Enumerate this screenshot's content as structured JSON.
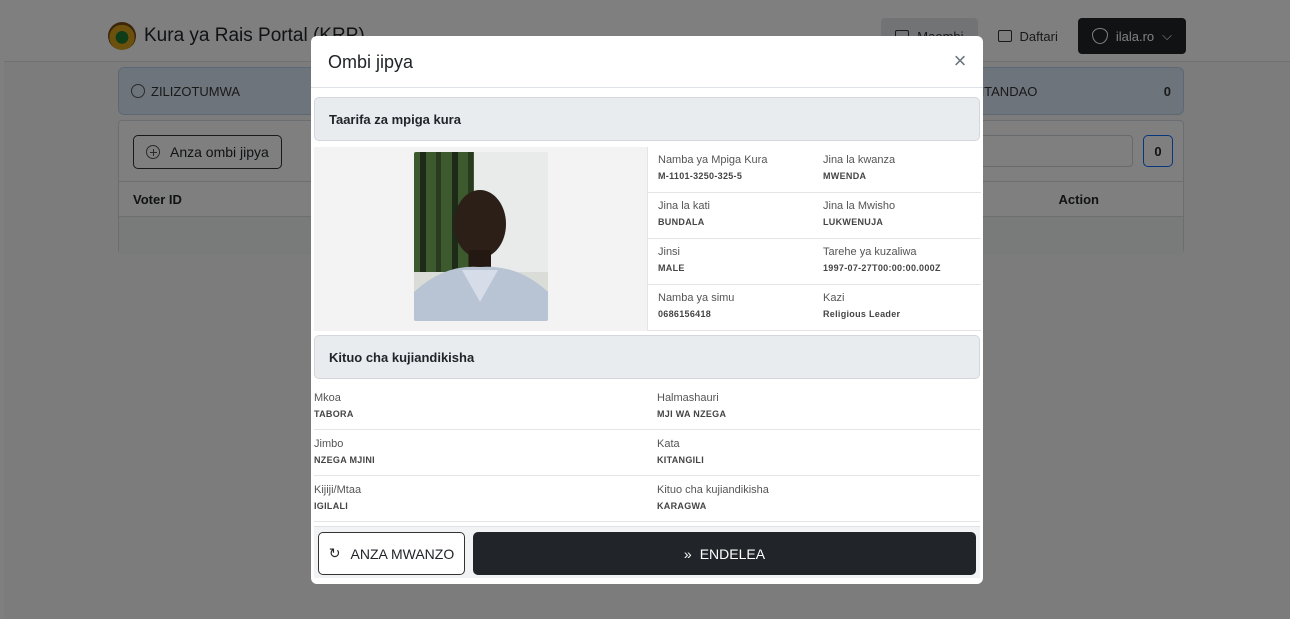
{
  "app": {
    "brand": "Kura ya Rais Portal (KRP)"
  },
  "nav": {
    "active_item": "Maombi",
    "daftari": "Daftari",
    "user": "ilala.ro"
  },
  "stats": {
    "left_label": "ZILIZOTUMWA",
    "right_label": "MAOMBI MTANDAO",
    "right_count": "0"
  },
  "table": {
    "new_button": "Anza ombi jipya",
    "count": "0",
    "col_voter": "Voter ID",
    "col_action": "Action"
  },
  "modal": {
    "title": "Ombi jipya",
    "close": "×",
    "voter_section": "Taarifa za mpiga kura",
    "station_section": "Kituo cha kujiandikisha",
    "voter_fields": [
      {
        "label": "Namba ya Mpiga Kura",
        "value": "M-1101-3250-325-5"
      },
      {
        "label": "Jina la kwanza",
        "value": "MWENDA"
      },
      {
        "label": "Jina la kati",
        "value": "BUNDALA"
      },
      {
        "label": "Jina la Mwisho",
        "value": "LUKWENUJA"
      },
      {
        "label": "Jinsi",
        "value": "MALE"
      },
      {
        "label": "Tarehe ya kuzaliwa",
        "value": "1997-07-27T00:00:00.000Z"
      },
      {
        "label": "Namba ya simu",
        "value": "0686156418"
      },
      {
        "label": "Kazi",
        "value": "Religious Leader"
      }
    ],
    "station_fields": [
      {
        "label": "Mkoa",
        "value": "TABORA"
      },
      {
        "label": "Halmashauri",
        "value": "MJI WA NZEGA"
      },
      {
        "label": "Jimbo",
        "value": "NZEGA MJINI"
      },
      {
        "label": "Kata",
        "value": "KITANGILI"
      },
      {
        "label": "Kijiji/Mtaa",
        "value": "IGILALI"
      },
      {
        "label": "Kituo cha kujiandikisha",
        "value": "KARAGWA"
      }
    ],
    "restart_button": "ANZA MWANZO",
    "next_button": "ENDELEA"
  },
  "colors": {
    "dark_button": "#212529",
    "stat_card": "#dbe9f7",
    "section_header": "#e9ecef"
  }
}
